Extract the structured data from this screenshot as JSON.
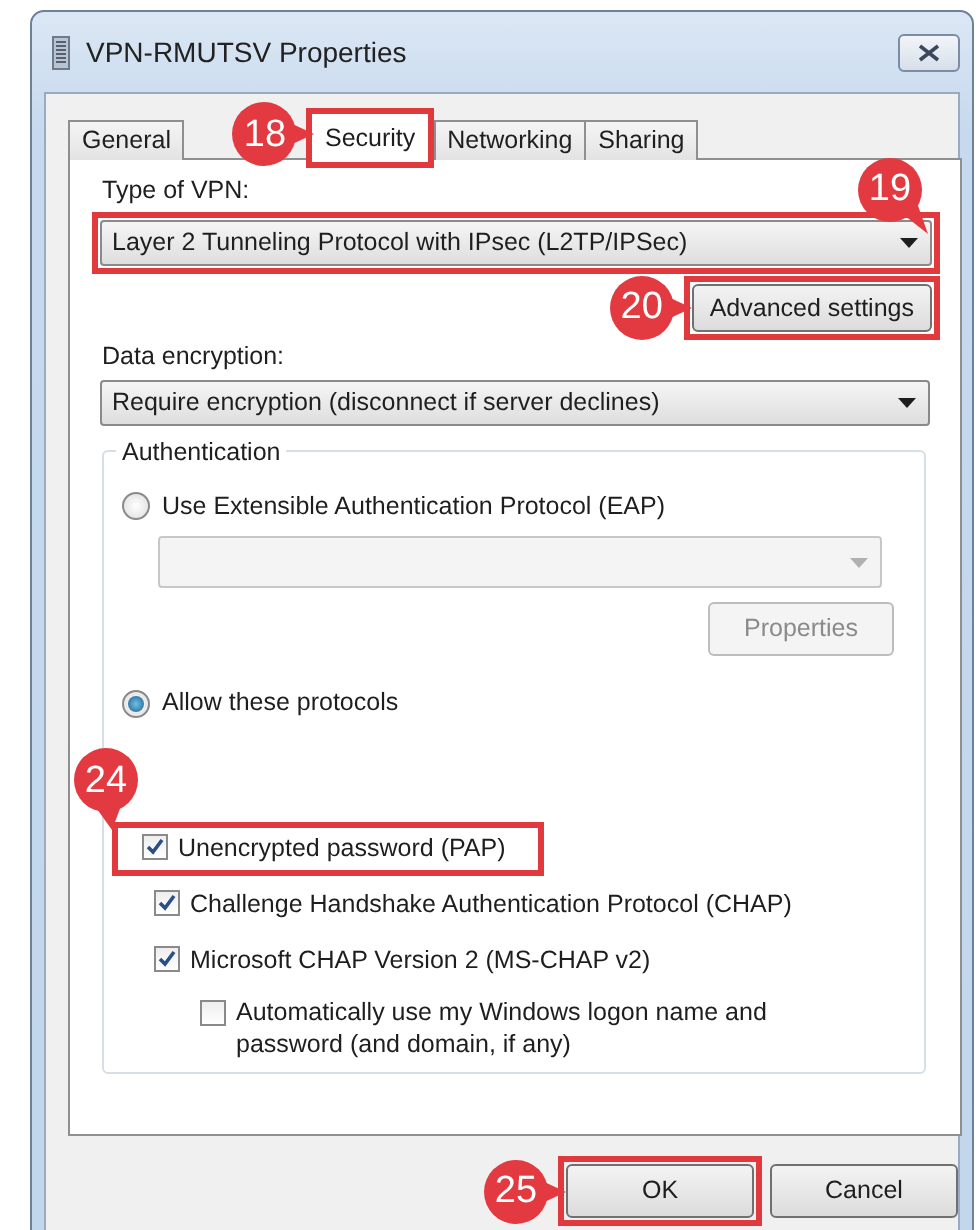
{
  "window": {
    "title": "VPN-RMUTSV Properties"
  },
  "tabs": [
    {
      "kind": "tab",
      "label": "General",
      "selected": false,
      "highlighted": false
    },
    {
      "kind": "tab",
      "label": "Security",
      "selected": true,
      "highlighted": true,
      "callout": "18"
    },
    {
      "kind": "tab",
      "label": "Networking",
      "selected": false,
      "highlighted": false
    },
    {
      "kind": "tab",
      "label": "Sharing",
      "selected": false,
      "highlighted": false
    }
  ],
  "type_of_vpn": {
    "label": "Type of VPN:",
    "value": "Layer 2 Tunneling Protocol with IPsec (L2TP/IPSec)",
    "highlighted": true,
    "callout": "19"
  },
  "advanced_settings_button": {
    "label": "Advanced settings",
    "highlighted": true,
    "callout": "20"
  },
  "data_encryption": {
    "label": "Data encryption:",
    "value": "Require encryption (disconnect if server declines)"
  },
  "authentication": {
    "title": "Authentication",
    "options": [
      {
        "label": "Use Extensible Authentication Protocol (EAP)",
        "selected": false
      },
      {
        "label": "Allow these protocols",
        "selected": true
      }
    ],
    "eap_dropdown": {
      "disabled": true
    },
    "properties_button": {
      "label": "Properties",
      "disabled": true
    },
    "protocols": [
      {
        "kind": "protocol",
        "label": "Unencrypted password (PAP)",
        "checked": true,
        "highlighted": true,
        "callout": "24"
      },
      {
        "kind": "protocol",
        "label": "Challenge Handshake Authentication Protocol (CHAP)",
        "checked": true,
        "highlighted": false
      },
      {
        "kind": "protocol",
        "label": "Microsoft CHAP Version 2 (MS-CHAP v2)",
        "checked": true,
        "highlighted": false
      },
      {
        "kind": "sub",
        "label": "Automatically use my Windows logon name and password (and domain, if any)",
        "checked": false,
        "highlighted": false
      }
    ]
  },
  "buttons": [
    {
      "label": "OK",
      "highlighted": true,
      "callout": "25"
    },
    {
      "label": "Cancel",
      "highlighted": false
    }
  ]
}
